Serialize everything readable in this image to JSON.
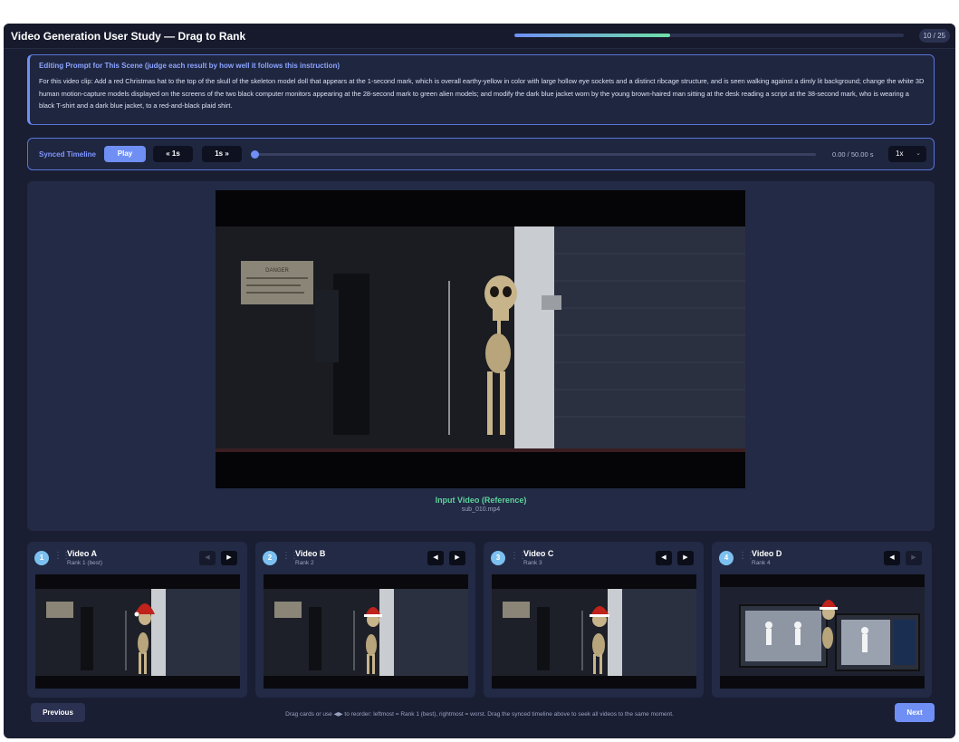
{
  "header": {
    "title": "Video Generation User Study — Drag to Rank",
    "counter": "10 / 25",
    "progress": 0.4
  },
  "prompt": {
    "heading": "Editing Prompt for This Scene (judge each result by how well it follows this instruction)",
    "text": "For this video clip: Add a red Christmas hat to the top of the skull of the skeleton model doll that appears at the 1-second mark, which is overall earthy-yellow in color with large hollow eye sockets and a distinct ribcage structure, and is seen walking against a dimly lit background; change the white 3D human motion-capture models displayed on the screens of the two black computer monitors appearing at the 28-second mark to green alien models; and modify the dark blue jacket worn by the young brown-haired man sitting at the desk reading a script at the 38-second mark, who is wearing a black T-shirt and a dark blue jacket, to a red-and-black plaid shirt."
  },
  "timeline": {
    "label": "Synced Timeline",
    "play": "Play",
    "back": "« 1s",
    "forward": "1s »",
    "time": "0.00 / 50.00 s",
    "speed": "1x"
  },
  "reference": {
    "caption": "Input Video (Reference)",
    "filename": "sub_010.mp4",
    "sign_text": "DANGER"
  },
  "cards": [
    {
      "rank_num": "1",
      "title": "Video A",
      "rank": "Rank 1 (best)",
      "scene": "skeleton"
    },
    {
      "rank_num": "2",
      "title": "Video B",
      "rank": "Rank 2",
      "scene": "skeleton"
    },
    {
      "rank_num": "3",
      "title": "Video C",
      "rank": "Rank 3",
      "scene": "skeleton"
    },
    {
      "rank_num": "4",
      "title": "Video D",
      "rank": "Rank 4",
      "scene": "monitors"
    }
  ],
  "footer": {
    "previous": "Previous",
    "hint": "Drag cards or use ◀▶ to reorder: leftmost = Rank 1 (best), rightmost = worst. Drag the synced timeline above to seek all videos to the same moment.",
    "next": "Next"
  },
  "colors": {
    "accent": "#6f8ff5",
    "success": "#5fd39a",
    "hat": "#c0221c"
  }
}
